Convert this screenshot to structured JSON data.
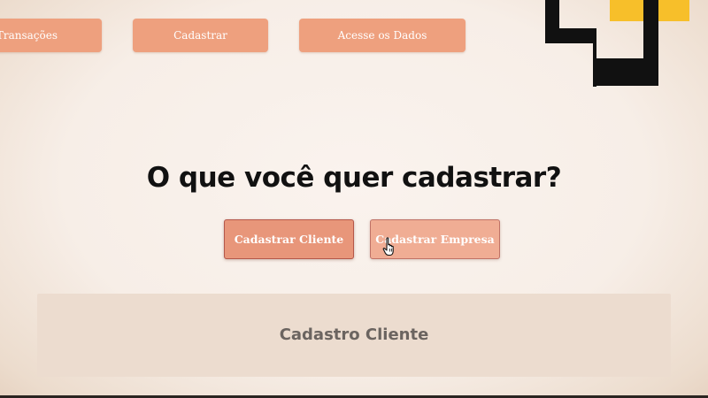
{
  "nav": {
    "items": [
      {
        "label": "Transações"
      },
      {
        "label": "Cadastrar"
      },
      {
        "label": "Acesse os Dados"
      }
    ]
  },
  "logo": {
    "icon": "brand-logo-icon",
    "colors": {
      "dark": "#111111",
      "accent": "#f7bf2a"
    }
  },
  "main": {
    "question": "O que você quer cadastrar?",
    "buttons": {
      "cliente": "Cadastrar Cliente",
      "empresa": "Cadastrar Empresa"
    }
  },
  "panel": {
    "title": "Cadastro Cliente"
  },
  "colors": {
    "button": "#eea07e",
    "button_border": "#b5574a",
    "background": "#f8f0ea",
    "panel": "#ecdccf",
    "panel_text": "#6b6460"
  }
}
